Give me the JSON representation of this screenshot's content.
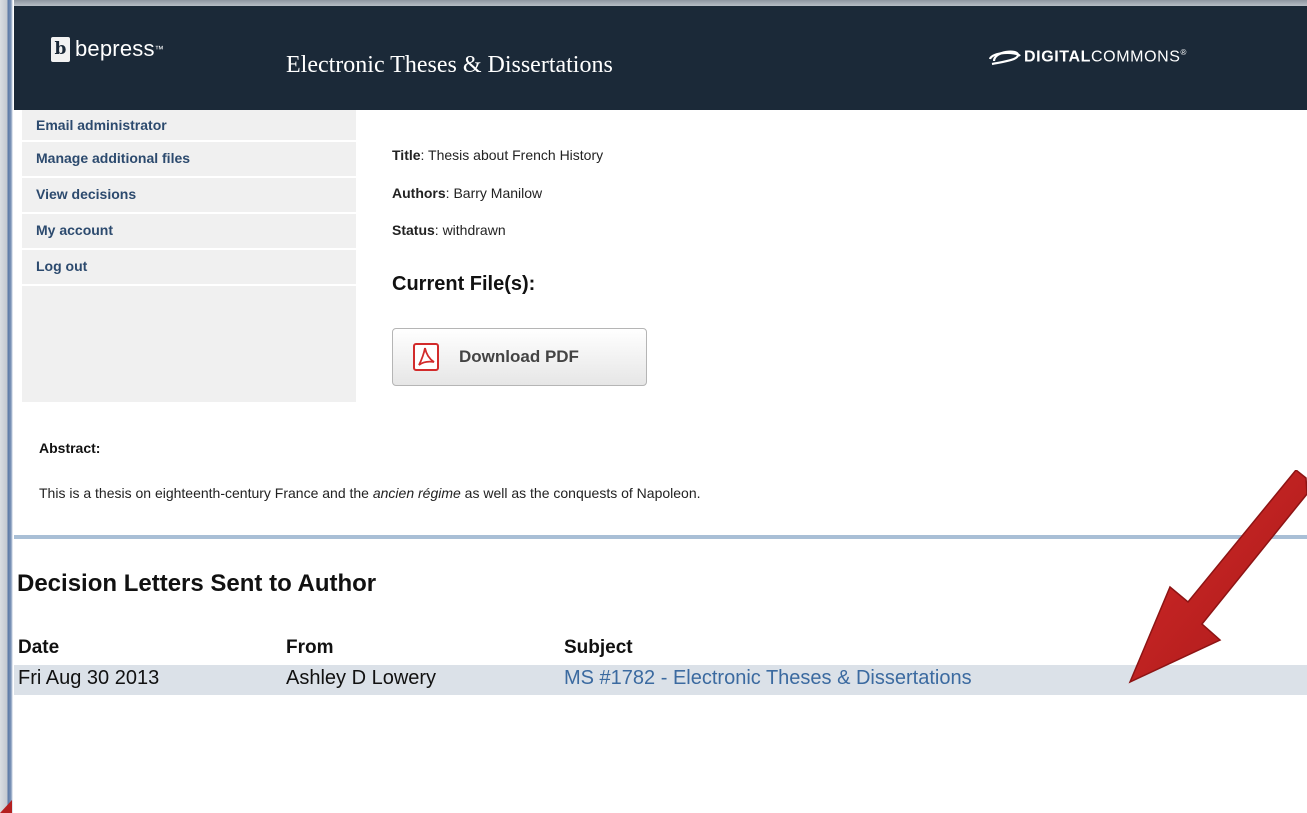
{
  "header": {
    "logo_mark": "b",
    "logo_text": "bepress",
    "logo_tm": "™",
    "site_title": "Electronic Theses & Dissertations",
    "partner_logo_bold": "DIGITAL",
    "partner_logo_rest": "COMMONS",
    "partner_logo_mark": "®",
    "bg_color": "#1b2938"
  },
  "sidebar": {
    "items": [
      {
        "label": "Email administrator"
      },
      {
        "label": "Manage additional files"
      },
      {
        "label": "View decisions"
      },
      {
        "label": "My account"
      },
      {
        "label": "Log out"
      }
    ],
    "link_color": "#2c4a6e"
  },
  "submission": {
    "title_label": "Title",
    "title_value": ": Thesis about French History",
    "authors_label": "Authors",
    "authors_value": ": Barry Manilow",
    "status_label": "Status",
    "status_value": ": withdrawn",
    "files_heading": "Current File(s):",
    "download_label": "Download PDF",
    "download_icon": "pdf-icon"
  },
  "abstract": {
    "label": "Abstract:",
    "text_before": "This is a thesis on eighteenth-century France and the ",
    "text_italic": "ancien régime",
    "text_after": " as well as the conquests of Napoleon."
  },
  "letters": {
    "heading": "Decision Letters Sent to Author",
    "columns": [
      "Date",
      "From",
      "Subject"
    ],
    "rows": [
      {
        "date": "Fri Aug 30 2013",
        "from": "Ashley D Lowery",
        "subject": "MS #1782 - Electronic Theses & Dissertations"
      }
    ],
    "row_bg": "#dbe1e8",
    "link_color": "#3b6aa0"
  },
  "annotation": {
    "arrow_color": "#c0201f",
    "arrow_icon": "red-arrow"
  }
}
